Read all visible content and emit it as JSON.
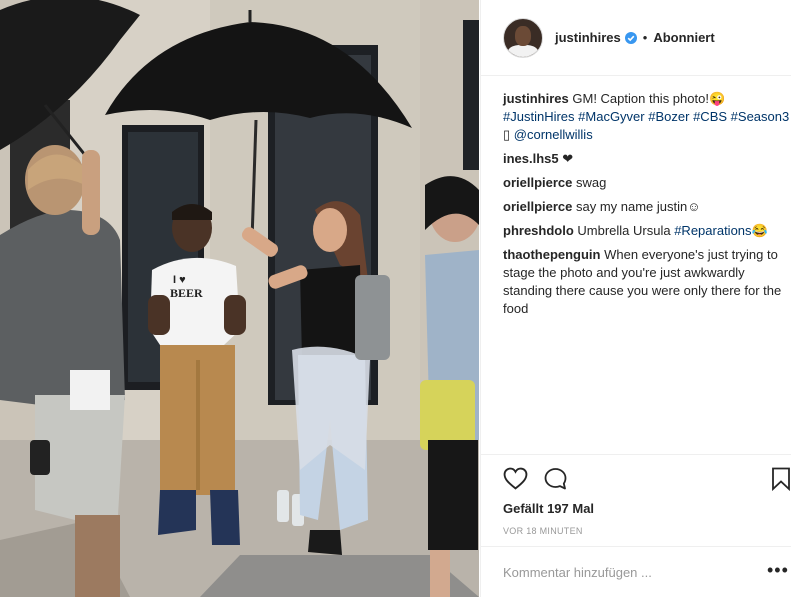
{
  "post": {
    "author": "justinhires",
    "follow_separator": "•",
    "follow_status": "Abonniert"
  },
  "comments": [
    {
      "user": "justinhires",
      "parts": [
        {
          "kind": "txt",
          "text": "GM! Caption this photo!😜 "
        },
        {
          "kind": "tag",
          "text": "#JustinHires"
        },
        {
          "kind": "txt",
          "text": " "
        },
        {
          "kind": "tag",
          "text": "#MacGyver"
        },
        {
          "kind": "txt",
          "text": " "
        },
        {
          "kind": "tag",
          "text": "#Bozer"
        },
        {
          "kind": "txt",
          "text": " "
        },
        {
          "kind": "tag",
          "text": "#CBS"
        },
        {
          "kind": "txt",
          "text": " "
        },
        {
          "kind": "tag",
          "text": "#Season3"
        },
        {
          "kind": "txt",
          "text": " ▯ "
        },
        {
          "kind": "tag",
          "text": "@cornellwillis"
        }
      ]
    },
    {
      "user": "ines.lhs5",
      "parts": [
        {
          "kind": "txt",
          "text": " ❤"
        }
      ]
    },
    {
      "user": "oriellpierce",
      "parts": [
        {
          "kind": "txt",
          "text": " swag"
        }
      ]
    },
    {
      "user": "oriellpierce",
      "parts": [
        {
          "kind": "txt",
          "text": " say my name justin☺"
        }
      ]
    },
    {
      "user": "phreshdolo",
      "parts": [
        {
          "kind": "txt",
          "text": " Umbrella Ursula "
        },
        {
          "kind": "tag",
          "text": "#Reparations😂"
        }
      ]
    },
    {
      "user": "thaothepenguin",
      "parts": [
        {
          "kind": "txt",
          "text": " When everyone's just trying to stage the photo and you're just awkwardly standing there cause you were only there for the food"
        }
      ]
    }
  ],
  "stats": {
    "likes": "Gefällt 197 Mal",
    "posted": "VOR 18 MINUTEN"
  },
  "add_comment": {
    "placeholder": "Kommentar hinzufügen ...",
    "more_label": "•••"
  },
  "photo": {
    "tshirt_line1": "I ♥",
    "tshirt_line2": "BEER"
  },
  "icons": [
    "heart-icon",
    "comment-icon",
    "bookmark-icon",
    "verified-badge-icon"
  ],
  "colors": {
    "hashtag": "#003569",
    "verified": "#3897f0",
    "muted": "#999999"
  }
}
